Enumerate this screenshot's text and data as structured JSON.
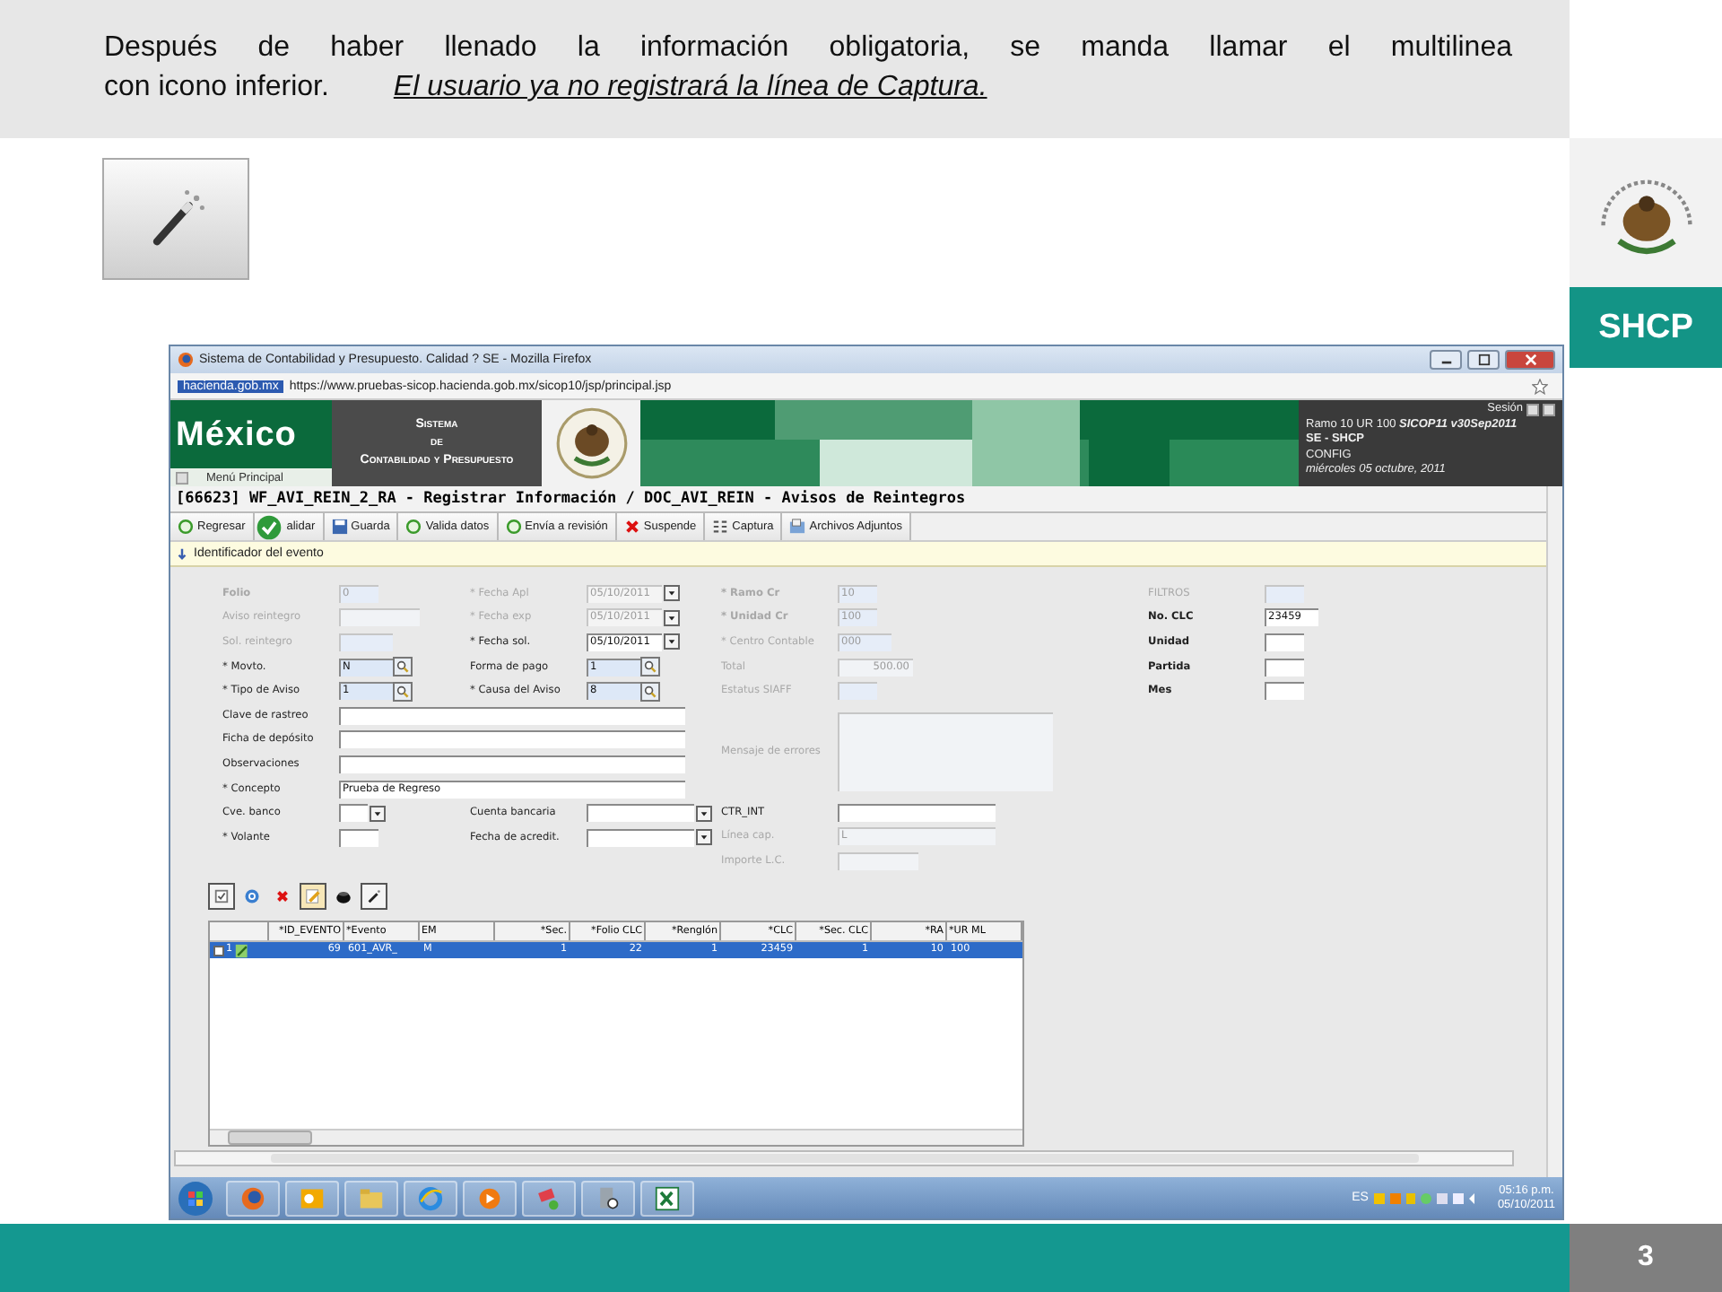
{
  "slide": {
    "caption_lines": [
      "Después de haber llenado la información obligatoria, se manda llamar el multilinea",
      "con icono inferior."
    ],
    "caption_link": "El usuario ya no registrará la línea de Captura.",
    "badge": "SHCP",
    "page_number": "3"
  },
  "browser": {
    "title": "Sistema de Contabilidad y Presupuesto. Calidad ? SE - Mozilla Firefox",
    "site_badge": "hacienda.gob.mx",
    "url": "https://www.pruebas-sicop.hacienda.gob.mx/sicop10/jsp/principal.jsp"
  },
  "header": {
    "logo": "México",
    "menu": "Menú Principal",
    "system_lines": [
      "Sistema",
      "de",
      "Contabilidad y Presupuesto"
    ],
    "session_label": "Sesión",
    "session_lines": [
      {
        "text": "Ramo 10 UR 100  **SICOP11 v30Sep2011**",
        "kind": "info"
      },
      {
        "text": "SE - SHCP",
        "kind": "unit"
      },
      {
        "text": "CONFIG",
        "kind": "info"
      },
      {
        "text": "miércoles 05 octubre, 2011",
        "kind": "date"
      }
    ]
  },
  "page_title": "[66623]  WF_AVI_REIN_2_RA - Registrar Información / DOC_AVI_REIN - Avisos de Reintegros",
  "toolbar": [
    {
      "label": "Regresar",
      "kind": "circle"
    },
    {
      "label": "alidar",
      "kind": "check"
    },
    {
      "label": "Guarda",
      "kind": "disk"
    },
    {
      "label": "Valida datos",
      "kind": "circle"
    },
    {
      "label": "Envía a revisión",
      "kind": "circle"
    },
    {
      "label": "Suspende",
      "kind": "cross"
    },
    {
      "label": "Captura",
      "kind": "grid"
    },
    {
      "label": "Archivos Adjuntos",
      "kind": "attach"
    }
  ],
  "section": "Identificador del evento",
  "form": {
    "left_top": [
      [
        {
          "label": "Folio",
          "value": "0",
          "kind": "tiny",
          "disabled": true,
          "bold": true
        },
        {
          "label": "Aviso reintegro",
          "kind": "medium",
          "disabled": true
        },
        {
          "label": "Sol. reintegro",
          "kind": "short",
          "disabled": true
        },
        {
          "label": "* Movto.",
          "value": "N",
          "kind": "lookup",
          "disabled": false
        },
        {
          "label": "* Tipo de Aviso",
          "value": "1",
          "kind": "lookup",
          "disabled": false
        }
      ],
      [
        {
          "label": "* Fecha Apl",
          "value": "05/10/2011",
          "kind": "date",
          "disabled": true
        },
        {
          "label": "* Fecha exp",
          "value": "05/10/2011",
          "kind": "date",
          "disabled": true
        },
        {
          "label": "* Fecha sol.",
          "value": "05/10/2011",
          "kind": "date",
          "disabled": false
        },
        {
          "label": "Forma de pago",
          "value": "1",
          "kind": "lookup",
          "disabled": false
        },
        {
          "label": "* Causa del Aviso",
          "value": "8",
          "kind": "lookup",
          "disabled": false
        }
      ]
    ],
    "left_wide": [
      {
        "label": "Clave de rastreo",
        "kind": "wide",
        "disabled": false
      },
      {
        "label": "Ficha de depósito",
        "kind": "wide",
        "disabled": false
      },
      {
        "label": "Observaciones",
        "kind": "wide",
        "disabled": false
      },
      {
        "label": "* Concepto",
        "value": "Prueba de Regreso",
        "kind": "wide",
        "disabled": false
      }
    ],
    "left_bottom": [
      [
        {
          "label": "Cve. banco",
          "kind": "select",
          "disabled": false
        },
        {
          "label": "* Volante",
          "kind": "tiny",
          "disabled": false
        }
      ],
      [
        {
          "label": "Cuenta bancaria",
          "kind": "select-wide",
          "disabled": false
        },
        {
          "label": "Fecha de acredit.",
          "kind": "select-wide",
          "disabled": false
        }
      ]
    ],
    "middle": [
      {
        "label": "* Ramo Cr",
        "value": "10",
        "kind": "tiny",
        "disabled": true,
        "bold": true
      },
      {
        "label": "* Unidad Cr",
        "value": "100",
        "kind": "tiny",
        "disabled": true,
        "bold": true
      },
      {
        "label": "* Centro Contable",
        "value": "000",
        "kind": "short",
        "disabled": true
      },
      {
        "label": "Total",
        "value": "500.00",
        "kind": "amount",
        "disabled": true
      },
      {
        "label": "Estatus SIAFF",
        "kind": "tiny",
        "disabled": true
      },
      {
        "label": "Mensaje de errores",
        "kind": "textarea",
        "disabled": true
      },
      {
        "label": "CTR_INT",
        "kind": "long",
        "disabled": false
      },
      {
        "label": "Línea cap.",
        "value": "L",
        "kind": "long",
        "disabled": true
      },
      {
        "label": "Importe L.C.",
        "kind": "medium",
        "disabled": true
      }
    ],
    "filters": [
      {
        "label": "FILTROS",
        "kind": "tiny",
        "disabled": true
      },
      {
        "label": "No. CLC",
        "value": "23459",
        "kind": "short",
        "disabled": false,
        "bold": true
      },
      {
        "label": "Unidad",
        "kind": "tiny",
        "disabled": false,
        "bold": true
      },
      {
        "label": "Partida",
        "kind": "tiny",
        "disabled": false,
        "bold": true
      },
      {
        "label": "Mes",
        "kind": "tiny",
        "disabled": false,
        "bold": true
      }
    ]
  },
  "grid_tools": [
    {
      "kind": "checkbox"
    },
    {
      "kind": "target"
    },
    {
      "kind": "cross"
    },
    {
      "kind": "pencil"
    },
    {
      "kind": "blob"
    },
    {
      "kind": "wand"
    }
  ],
  "table": {
    "columns": [
      {},
      {
        "label": "*ID_EVENTO"
      },
      {
        "label": "*Evento"
      },
      {
        "label": "EM"
      },
      {
        "label": "*Sec."
      },
      {
        "label": "*Folio CLC"
      },
      {
        "label": "*Renglón"
      },
      {
        "label": "*CLC"
      },
      {
        "label": "*Sec. CLC"
      },
      {
        "label": "*RA"
      },
      {
        "label": "*UR ML"
      }
    ],
    "rows": [
      {
        "selected": true,
        "checked": false,
        "cells": [
          "1",
          "69",
          "601_AVR_",
          "M",
          "1",
          "22",
          "1",
          "23459",
          "1",
          "10",
          "100"
        ]
      }
    ]
  },
  "taskbar": {
    "apps": [
      {
        "kind": "firefox"
      },
      {
        "kind": "outlook"
      },
      {
        "kind": "folder"
      },
      {
        "kind": "ie"
      },
      {
        "kind": "media"
      },
      {
        "kind": "tool"
      },
      {
        "kind": "server"
      },
      {
        "kind": "excel"
      }
    ],
    "language": "ES",
    "time": "05:16 p.m.",
    "date": "05/10/2011"
  }
}
